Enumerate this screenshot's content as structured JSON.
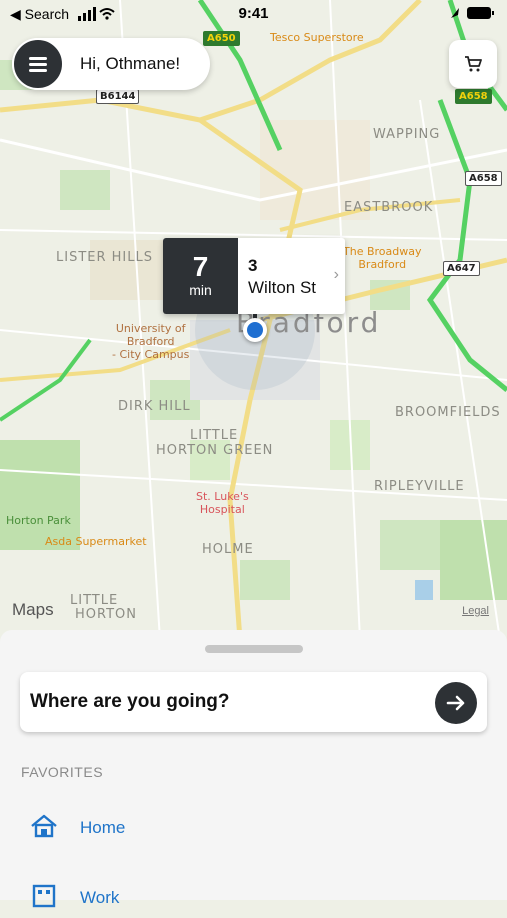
{
  "status_bar": {
    "back_label": "◀ Search",
    "time": "9:41"
  },
  "header": {
    "greeting": "Hi, Othmane!",
    "menu_icon": "hamburger-icon",
    "cart_icon": "cart-icon"
  },
  "map": {
    "areas": [
      "WAPPING",
      "EASTBROOK",
      "LISTER HILLS",
      "DIRK HILL",
      "LITTLE",
      "HORTON GREEN",
      "BROOMFIELDS",
      "RIPLEYVILLE",
      "HOLME",
      "LITTLE",
      "HORTON"
    ],
    "city": "Bradford",
    "pois": {
      "tesco": "Tesco Superstore",
      "broadway_line1": "The Broadway",
      "broadway_line2": "Bradford",
      "uni_line1": "University of",
      "uni_line2": "Bradford",
      "uni_line3": "- City Campus",
      "stlukes_line1": "St. Luke's",
      "stlukes_line2": "Hospital",
      "horton_park": "Horton Park",
      "asda": "Asda Supermarket"
    },
    "road_signs": [
      "A650",
      "B6144",
      "A658",
      "A658",
      "A647"
    ],
    "attribution": "Maps",
    "legal": "Legal"
  },
  "eta_callout": {
    "minutes": "7",
    "unit": "min",
    "address_line1": "3",
    "address_line2": "Wilton St"
  },
  "sheet": {
    "search_placeholder": "Where are you going?",
    "favorites_header": "FAVORITES",
    "favorites": [
      {
        "label": "Home",
        "icon": "home-icon"
      },
      {
        "label": "Work",
        "icon": "work-icon"
      }
    ]
  },
  "colors": {
    "dark": "#2d3135",
    "link_blue": "#1f74c9",
    "location_blue": "#1f6fd1"
  }
}
